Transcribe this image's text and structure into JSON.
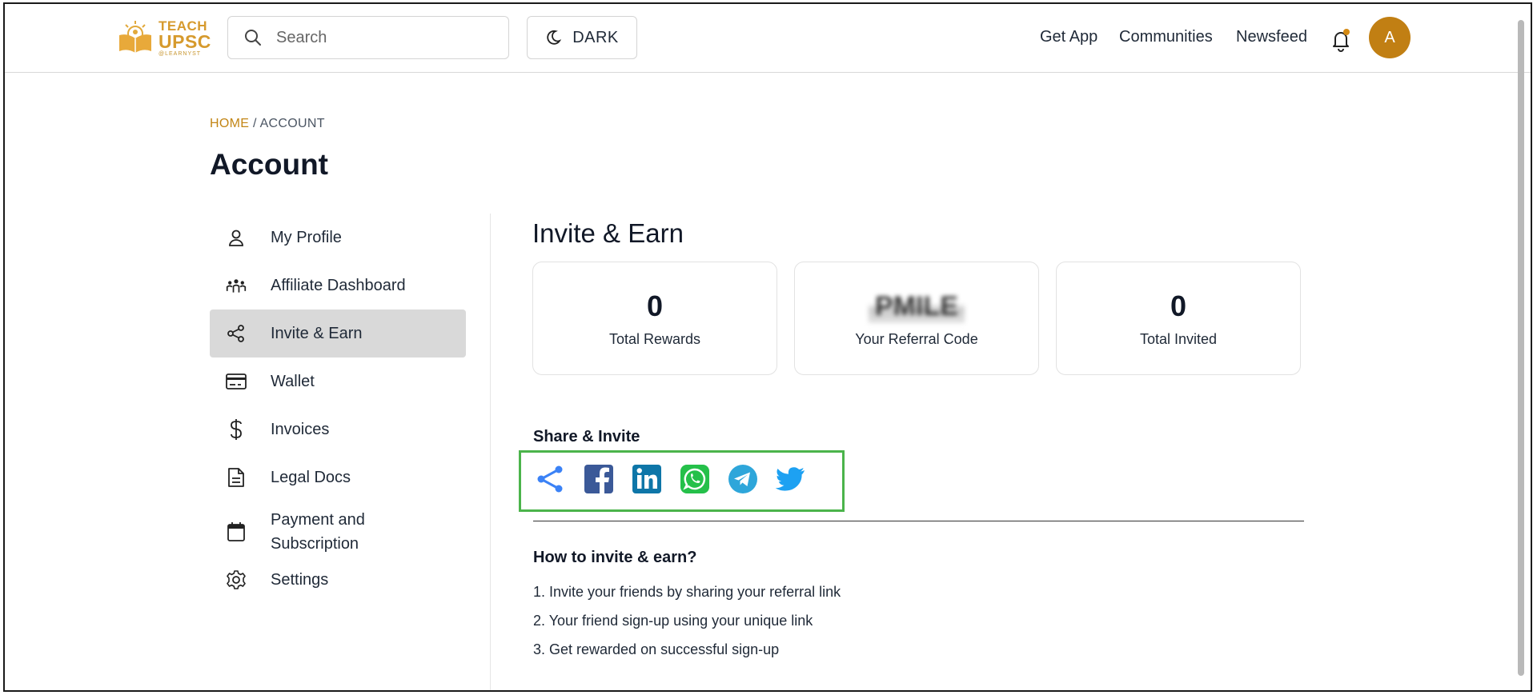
{
  "header": {
    "logo": {
      "line1": "TEACH",
      "line2": "UPSC",
      "line3": "@LEARNYST"
    },
    "search_placeholder": "Search",
    "dark_label": "DARK",
    "nav": [
      "Get App",
      "Communities",
      "Newsfeed"
    ],
    "avatar_initial": "A",
    "accent_color": "#c17f13"
  },
  "breadcrumb": {
    "home": "HOME",
    "separator": "/",
    "current": "ACCOUNT"
  },
  "page_title": "Account",
  "sidebar": {
    "items": [
      {
        "label": "My Profile",
        "icon": "user-icon"
      },
      {
        "label": "Affiliate Dashboard",
        "icon": "people-group-icon"
      },
      {
        "label": "Invite & Earn",
        "icon": "share-nodes-icon",
        "active": true
      },
      {
        "label": "Wallet",
        "icon": "card-icon"
      },
      {
        "label": "Invoices",
        "icon": "dollar-icon"
      },
      {
        "label": "Legal Docs",
        "icon": "document-icon"
      },
      {
        "label": "Payment and Subscription",
        "icon": "calendar-icon"
      },
      {
        "label": "Settings",
        "icon": "gear-icon"
      }
    ]
  },
  "main": {
    "title": "Invite & Earn",
    "stats": [
      {
        "value": "0",
        "caption": "Total Rewards"
      },
      {
        "value": "PMILE",
        "caption": "Your Referral Code"
      },
      {
        "value": "0",
        "caption": "Total Invited"
      }
    ],
    "share_label": "Share & Invite",
    "share_icons": [
      "share-icon",
      "facebook-icon",
      "linkedin-icon",
      "whatsapp-icon",
      "telegram-icon",
      "twitter-icon"
    ],
    "howto_title": "How to invite & earn?",
    "steps": [
      "1.  Invite your friends by sharing your referral link",
      "2.  Your friend sign-up using your unique link",
      "3.  Get rewarded on successful sign-up"
    ],
    "highlight_color": "#4bb44b"
  }
}
